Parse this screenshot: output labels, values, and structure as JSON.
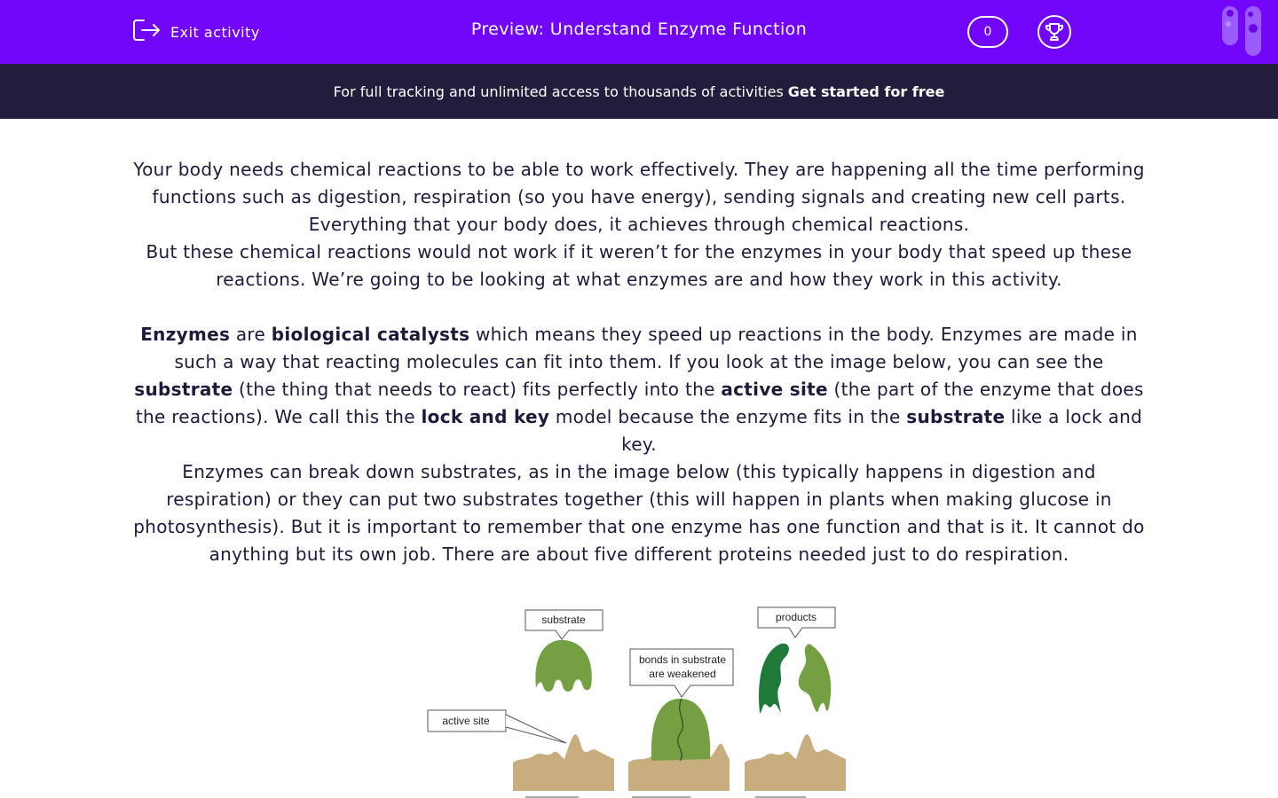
{
  "header": {
    "exit_label": "Exit activity",
    "title": "Preview: Understand Enzyme Function",
    "counter": "0",
    "exit_icon": "exit-icon",
    "trophy_icon": "trophy-icon",
    "logo_icon": "edplace-logo-icon"
  },
  "promo": {
    "text": "For full tracking and unlimited access to thousands of activities",
    "cta": "Get started for free"
  },
  "content": {
    "p1": "Your body needs chemical reactions to be able to work effectively. They are happening all the time performing functions such as digestion, respiration (so you have energy), sending signals and creating new cell parts. Everything that your body does, it achieves through chemical reactions.",
    "p2": "But these chemical reactions would not work if it weren’t for the enzymes in your body that speed up these reactions. We’re going to be looking at what enzymes are and how they work in this activity.",
    "p3": {
      "t1": "Enzymes",
      "t2": " are ",
      "t3": "biological catalysts",
      "t4": " which means they speed up reactions in the body. Enzymes are made in such a way that reacting molecules can fit into them. If you look at the image below, you can see the ",
      "t5": "substrate",
      "t6": " (the thing that needs to react) fits perfectly into the ",
      "t7": "active site",
      "t8": " (the part of the enzyme that does the reactions). We call this the ",
      "t9": "lock and key",
      "t10": " model because the enzyme fits in the ",
      "t11": "substrate",
      "t12": " like a lock and key."
    },
    "p4": "Enzymes can break down substrates, as in the image below (this typically happens in digestion and respiration) or they can put two substrates together (this will happen in plants when making glucose in photosynthesis). But it is important to remember that one enzyme has one function and that is it. It cannot do anything but its own job. There are about five different proteins needed just to do respiration."
  },
  "diagram": {
    "label_substrate": "substrate",
    "label_active_site": "active site",
    "label_bonds_1": "bonds in substrate",
    "label_bonds_2": "are weakened",
    "label_products": "products",
    "colors": {
      "substrate": "#74a043",
      "product": "#1f7a3a",
      "enzyme": "#c8ad7f"
    }
  }
}
